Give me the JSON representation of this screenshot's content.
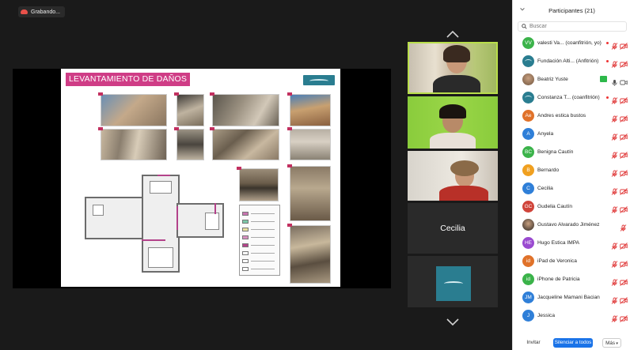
{
  "recording": {
    "label": "Grabando..."
  },
  "slide": {
    "title": "LEVANTAMIENTO DE DAÑOS"
  },
  "video_tiles": [
    {
      "kind": "video",
      "active": true
    },
    {
      "kind": "video"
    },
    {
      "kind": "video"
    },
    {
      "kind": "name",
      "name": "Cecilia"
    },
    {
      "kind": "logo"
    }
  ],
  "panel": {
    "title": "Participantes (21)",
    "search_placeholder": "Buscar",
    "footer": {
      "invite": "Invitar",
      "mute_all": "Silenciar a todos",
      "more": "Más"
    }
  },
  "participants": [
    {
      "initials": "VV",
      "color": "#3bb34a",
      "name": "valesti Va... (coanfitrión, yo)",
      "rec": true,
      "mic": "red",
      "cam": "red"
    },
    {
      "initials": "",
      "color": "#2a7d90",
      "logo": true,
      "name": "Fundación Alti... (Anfitrión)",
      "rec": true,
      "mic": "red",
      "cam": "red"
    },
    {
      "initials": "",
      "color": "#8a6b52",
      "photo": true,
      "name": "Beatriz Yuste",
      "greencam": true,
      "mic": "gray",
      "cam": "gray"
    },
    {
      "initials": "",
      "color": "#2a7d90",
      "logo": true,
      "name": "Constanza T... (coanfitrión)",
      "rec": true,
      "mic": "red",
      "cam": "red"
    },
    {
      "initials": "Ae",
      "color": "#e0722a",
      "name": "Andres estica bustos",
      "mic": "red",
      "cam": "red"
    },
    {
      "initials": "A",
      "color": "#2f7fd8",
      "name": "Anyela",
      "mic": "red",
      "cam": "red"
    },
    {
      "initials": "BC",
      "color": "#3bb34a",
      "name": "Benigna Cautín",
      "mic": "red",
      "cam": "red"
    },
    {
      "initials": "B",
      "color": "#f0a020",
      "name": "Bernardo",
      "mic": "red",
      "cam": "red"
    },
    {
      "initials": "C",
      "color": "#2f7fd8",
      "name": "Cecilia",
      "mic": "red",
      "cam": "red"
    },
    {
      "initials": "GC",
      "color": "#d0443a",
      "name": "Gudelia Cautín",
      "mic": "red",
      "cam": "red"
    },
    {
      "initials": "",
      "color": "#5a4a3e",
      "photo": true,
      "name": "Gustavo Alvarado Jiménez",
      "mic": "red",
      "cam": "none"
    },
    {
      "initials": "HE",
      "color": "#9a4ad0",
      "name": "Hugo Estica IMPA",
      "mic": "red",
      "cam": "red"
    },
    {
      "initials": "id",
      "color": "#e0722a",
      "name": "iPad de Veronica",
      "mic": "red",
      "cam": "red"
    },
    {
      "initials": "id",
      "color": "#3bb34a",
      "name": "iPhone de Patricia",
      "mic": "red",
      "cam": "red"
    },
    {
      "initials": "JM",
      "color": "#2f7fd8",
      "name": "Jacqueline Mamani Bacian",
      "mic": "red",
      "cam": "red"
    },
    {
      "initials": "J",
      "color": "#2f7fd8",
      "name": "Jessica",
      "mic": "red",
      "cam": "red"
    }
  ]
}
